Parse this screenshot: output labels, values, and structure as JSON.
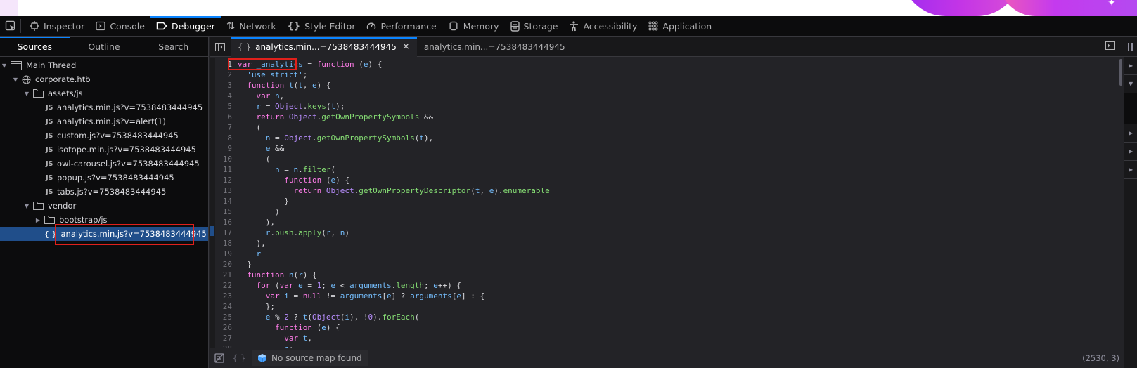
{
  "toolbar": {
    "tabs": [
      {
        "label": "Inspector",
        "icon": "inspector-icon"
      },
      {
        "label": "Console",
        "icon": "console-icon"
      },
      {
        "label": "Debugger",
        "icon": "debugger-icon",
        "active": true
      },
      {
        "label": "Network",
        "icon": "network-icon"
      },
      {
        "label": "Style Editor",
        "icon": "style-editor-icon"
      },
      {
        "label": "Performance",
        "icon": "performance-icon"
      },
      {
        "label": "Memory",
        "icon": "memory-icon"
      },
      {
        "label": "Storage",
        "icon": "storage-icon"
      },
      {
        "label": "Accessibility",
        "icon": "accessibility-icon"
      },
      {
        "label": "Application",
        "icon": "application-icon"
      }
    ]
  },
  "sidebar": {
    "tabs": [
      {
        "label": "Sources",
        "active": true
      },
      {
        "label": "Outline"
      },
      {
        "label": "Search"
      }
    ],
    "tree": [
      {
        "label": "Main Thread",
        "type": "thread",
        "expanded": true
      },
      {
        "label": "corporate.htb",
        "type": "domain",
        "expanded": true
      },
      {
        "label": "assets/js",
        "type": "folder",
        "expanded": true
      },
      {
        "label": "analytics.min.js?v=7538483444945",
        "type": "js"
      },
      {
        "label": "analytics.min.js?v=alert(1)",
        "type": "js"
      },
      {
        "label": "custom.js?v=7538483444945",
        "type": "js"
      },
      {
        "label": "isotope.min.js?v=7538483444945",
        "type": "js"
      },
      {
        "label": "owl-carousel.js?v=7538483444945",
        "type": "js"
      },
      {
        "label": "popup.js?v=7538483444945",
        "type": "js"
      },
      {
        "label": "tabs.js?v=7538483444945",
        "type": "js"
      },
      {
        "label": "vendor",
        "type": "folder",
        "expanded": true
      },
      {
        "label": "bootstrap/js",
        "type": "folder",
        "expanded": false
      },
      {
        "label": "analytics.min.js?v=7538483444945",
        "type": "pretty",
        "selected": true
      }
    ]
  },
  "editor": {
    "tabs": [
      {
        "label": "analytics.min...=7538483444945",
        "pretty": true,
        "active": true,
        "close": "×"
      },
      {
        "label": "analytics.min...=7538483444945"
      }
    ],
    "lines": [
      "var _analytics = function (e) {",
      "  'use strict';",
      "  function t(t, e) {",
      "    var n,",
      "    r = Object.keys(t);",
      "    return Object.getOwnPropertySymbols &&",
      "    (",
      "      n = Object.getOwnPropertySymbols(t),",
      "      e &&",
      "      (",
      "        n = n.filter(",
      "          function (e) {",
      "            return Object.getOwnPropertyDescriptor(t, e).enumerable",
      "          }",
      "        )",
      "      ),",
      "      r.push.apply(r, n)",
      "    ),",
      "    r",
      "  }",
      "  function n(r) {",
      "    for (var e = 1; e < arguments.length; e++) {",
      "      var i = null != arguments[e] ? arguments[e] : {",
      "      };",
      "      e % 2 ? t(Object(i), !0).forEach(",
      "        function (e) {",
      "          var t,",
      "          n;"
    ],
    "footer": {
      "source_map_status": "No source map found",
      "cursor_position": "(2530, 3)"
    }
  },
  "colors": {
    "accent": "#0a84ff",
    "selection": "#204e8a",
    "highlight_box": "#e0201b"
  }
}
